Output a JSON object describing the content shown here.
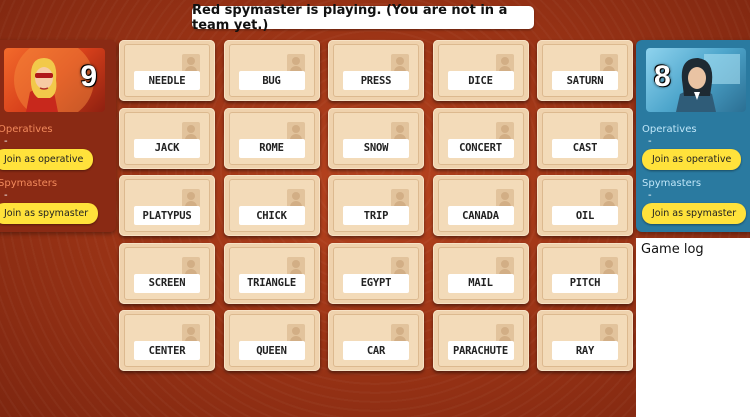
{
  "status": {
    "text": "Red spymaster is playing. (You are not in a team yet.)"
  },
  "red_team": {
    "score": "9",
    "operatives_label": "Operatives",
    "operatives_list": "-",
    "join_operative": "Join as operative",
    "spymasters_label": "Spymasters",
    "spymasters_list": "-",
    "join_spymaster": "Join as spymaster",
    "color": "#8a2a14"
  },
  "blue_team": {
    "score": "8",
    "operatives_label": "Operatives",
    "operatives_list": "-",
    "join_operative": "Join as operative",
    "spymasters_label": "Spymasters",
    "spymasters_list": "-",
    "join_spymaster": "Join as spymaster",
    "color": "#2a7aa0"
  },
  "board": {
    "cards": [
      "NEEDLE",
      "BUG",
      "PRESS",
      "DICE",
      "SATURN",
      "JACK",
      "ROME",
      "SNOW",
      "CONCERT",
      "CAST",
      "PLATYPUS",
      "CHICK",
      "TRIP",
      "CANADA",
      "OIL",
      "SCREEN",
      "TRIANGLE",
      "EGYPT",
      "MAIL",
      "PITCH",
      "CENTER",
      "QUEEN",
      "CAR",
      "PARACHUTE",
      "RAY"
    ]
  },
  "game_log": {
    "title": "Game log"
  },
  "colors": {
    "accent_button": "#ffe23b",
    "card": "#efd2ad",
    "background": "#9e3516"
  }
}
